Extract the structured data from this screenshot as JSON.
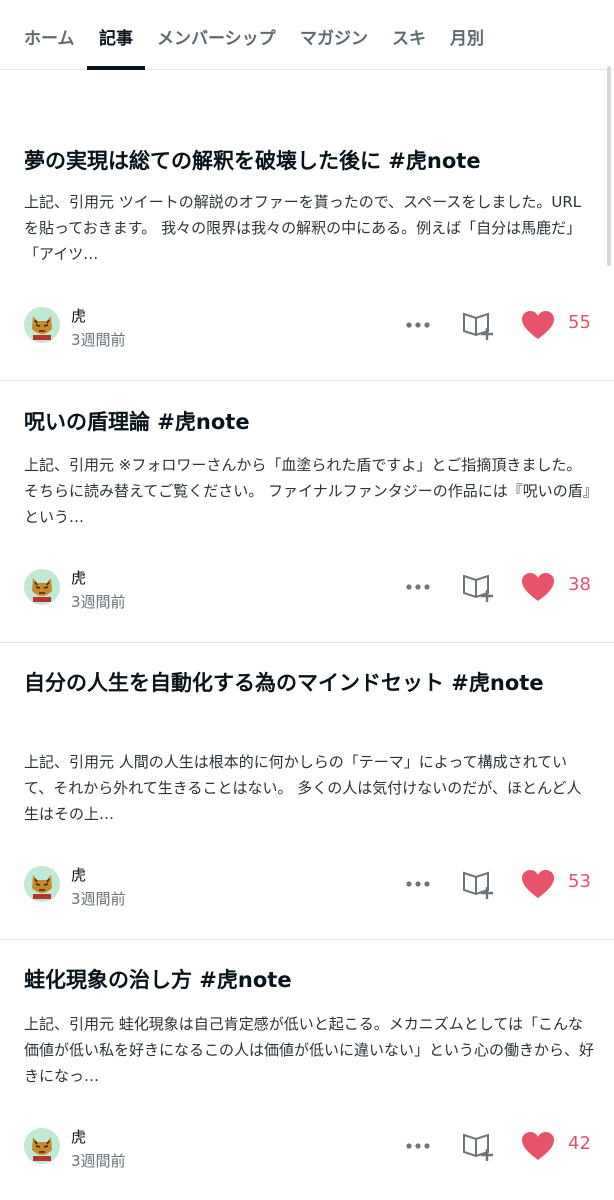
{
  "tabs": [
    {
      "label": "ホーム"
    },
    {
      "label": "記事"
    },
    {
      "label": "メンバーシップ"
    },
    {
      "label": "マガジン"
    },
    {
      "label": "スキ"
    },
    {
      "label": "月別"
    }
  ],
  "active_tab": "記事",
  "colors": {
    "accent": "#08131a",
    "heart": "#e8536b"
  },
  "articles": [
    {
      "title": "夢の実現は総ての解釈を破壊した後に #虎note",
      "excerpt": "上記、引用元 ツイートの解説のオファーを貰ったので、スペースをしました。URLを貼っておきます。 我々の限界は我々の解釈の中にある。例えば「自分は馬鹿だ」「アイツ…",
      "author": "虎",
      "date": "3週間前",
      "likes": "55"
    },
    {
      "title": "呪いの盾理論 #虎note",
      "excerpt": "上記、引用元 ※フォロワーさんから「血塗られた盾ですよ」とご指摘頂きました。そちらに読み替えてご覧ください。 ファイナルファンタジーの作品には『呪いの盾』という…",
      "author": "虎",
      "date": "3週間前",
      "likes": "38"
    },
    {
      "title": "自分の人生を自動化する為のマインドセット #虎note",
      "excerpt": "上記、引用元 人間の人生は根本的に何かしらの「テーマ」によって構成されていて、それから外れて生きることはない。 多くの人は気付けないのだが、ほとんど人生はその上…",
      "author": "虎",
      "date": "3週間前",
      "likes": "53"
    },
    {
      "title": "蛙化現象の治し方 #虎note",
      "excerpt": "上記、引用元 蛙化現象は自己肯定感が低いと起こる。メカニズムとしては「こんな価値が低い私を好きになるこの人は価値が低いに違いない」という心の働きから、好きになっ…",
      "author": "虎",
      "date": "3週間前",
      "likes": "42"
    }
  ]
}
